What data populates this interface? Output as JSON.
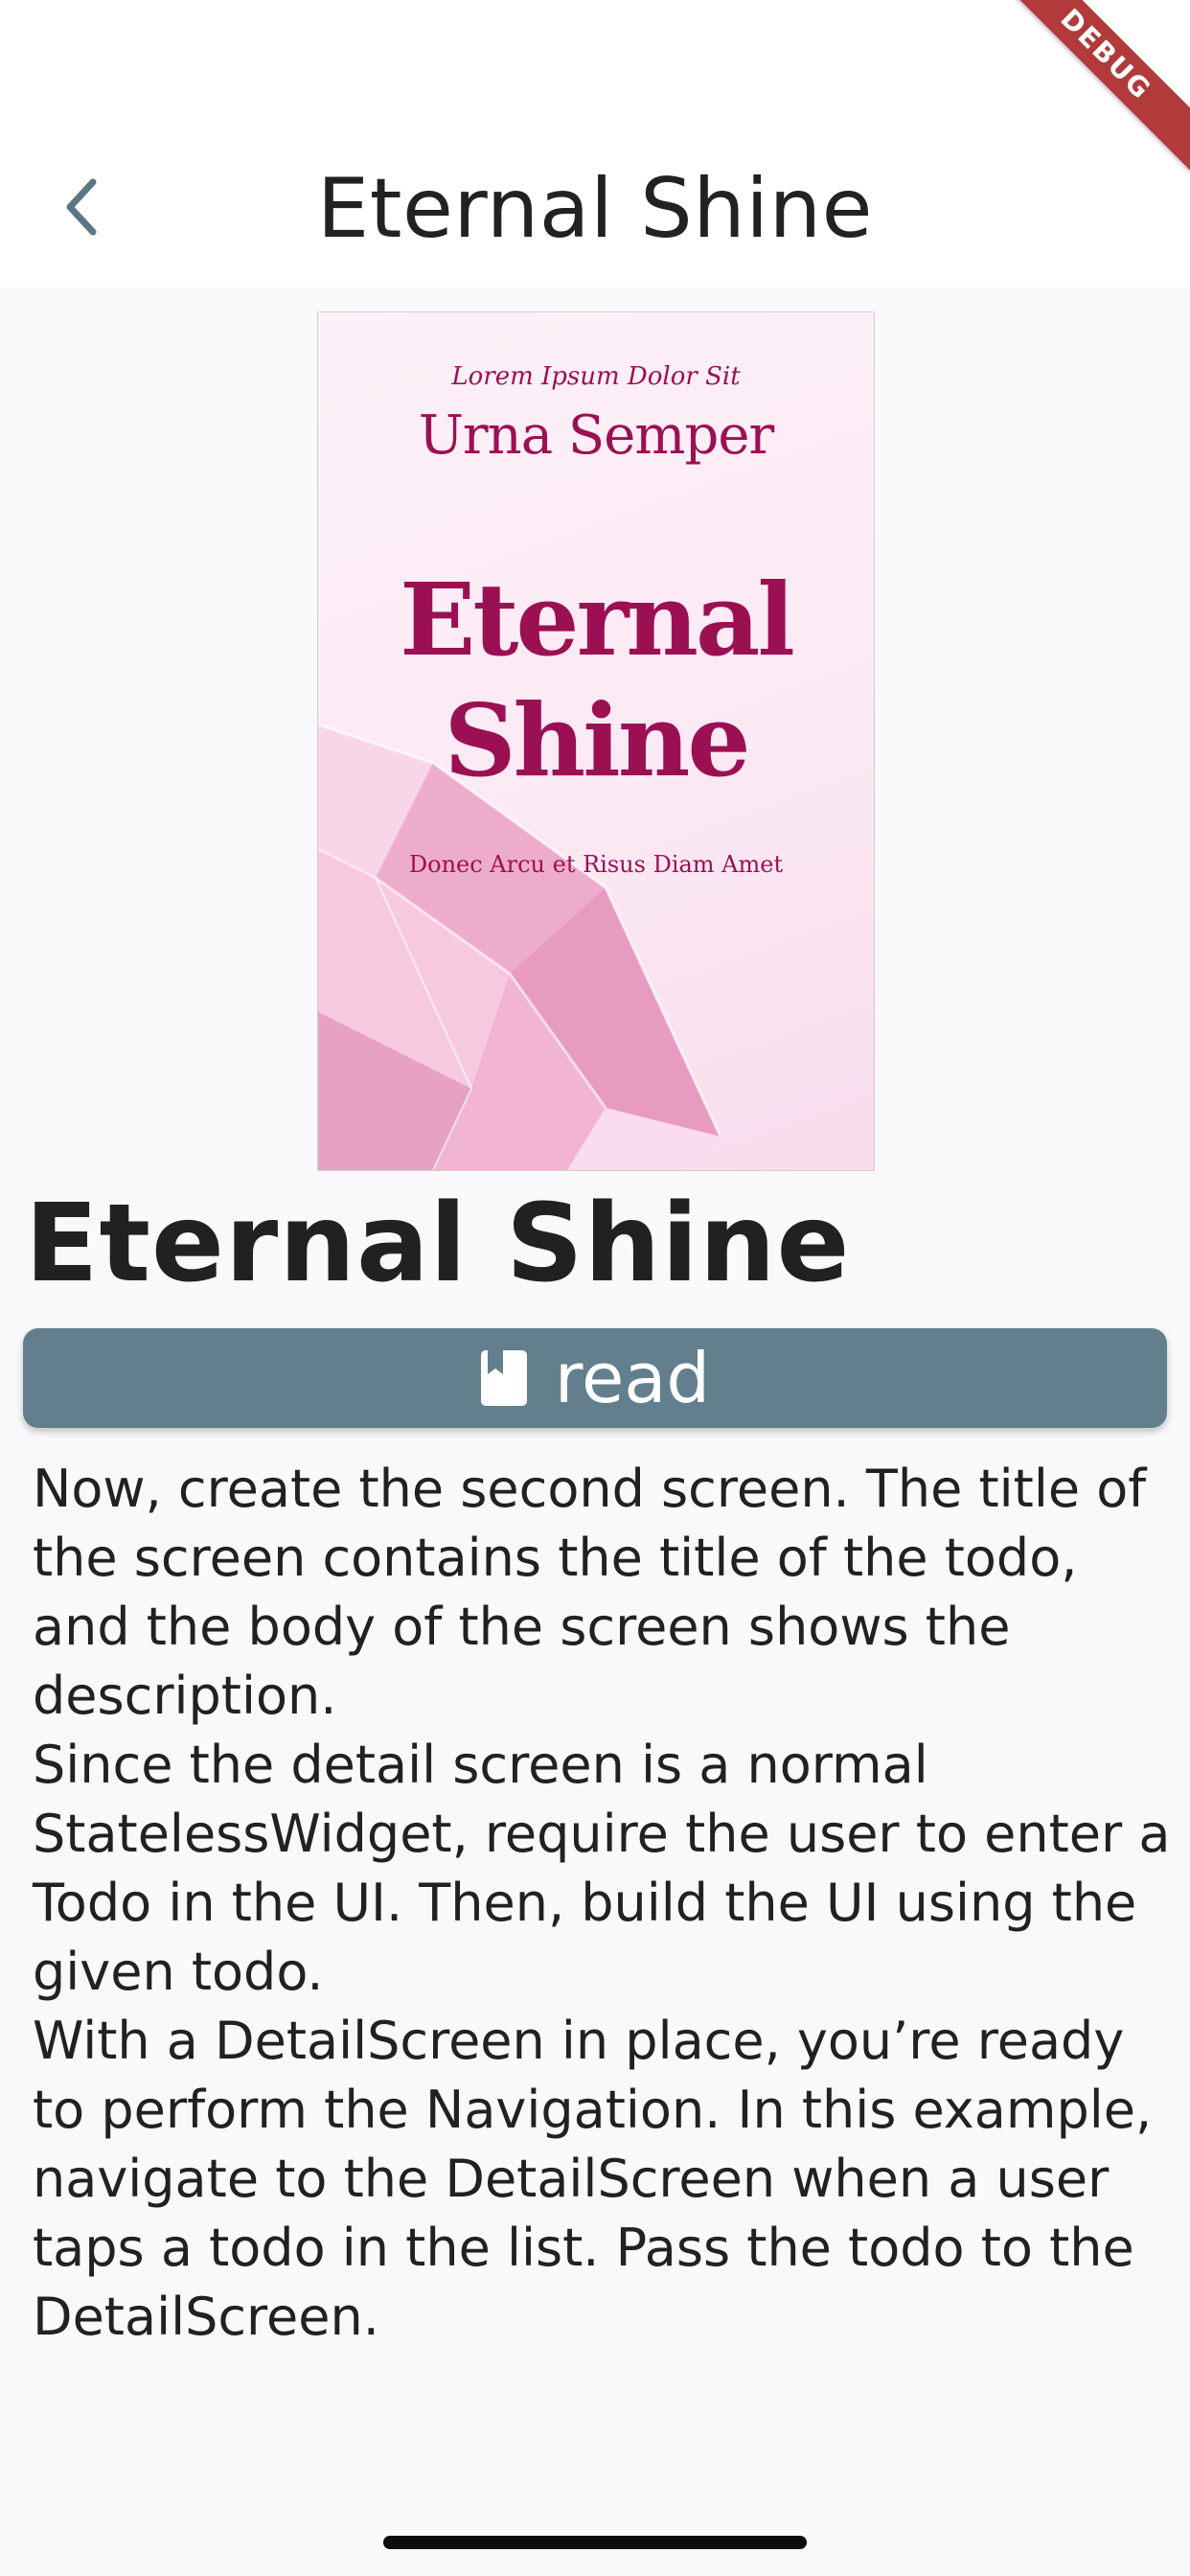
{
  "app_bar": {
    "title": "Eternal Shine",
    "back_icon": "chevron-left-icon",
    "debug_banner": "DEBUG"
  },
  "cover": {
    "top_line": "Lorem Ipsum Dolor Sit",
    "author": "Urna Semper",
    "title": "Eternal Shine",
    "subtitle": "Donec Arcu et Risus Diam Amet",
    "accent_color": "#9b1053"
  },
  "book": {
    "title": "Eternal Shine"
  },
  "read_button": {
    "label": "read",
    "icon": "bookmark-book-icon",
    "color": "#637f8d"
  },
  "description": [
    "Now, create the second screen. The title of the screen contains the title of the todo, and the body of the screen shows the description.",
    "Since the detail screen is a normal StatelessWidget, require the user to enter a Todo in the UI. Then, build the UI using the given todo.",
    "With a DetailScreen in place, you’re ready to perform the Navigation. In this example, navigate to the DetailScreen when a user taps a todo in the list. Pass the todo to the DetailScreen."
  ]
}
